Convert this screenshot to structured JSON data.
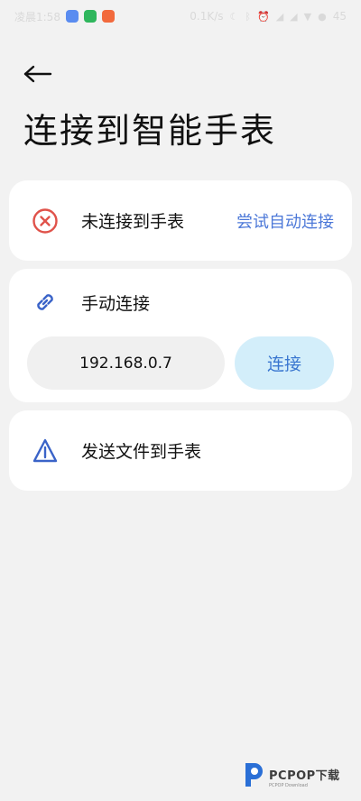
{
  "status_bar": {
    "time": "凌晨1:58",
    "network_speed": "0.1K/s",
    "battery": "45",
    "app_icons": [
      "blue-app-icon",
      "wechat-icon",
      "orange-app-icon"
    ]
  },
  "header": {
    "back_icon": "arrow-left-icon",
    "title": "连接到智能手表"
  },
  "connection_status": {
    "icon": "close-circle-icon",
    "icon_color": "#e0524a",
    "label": "未连接到手表",
    "action_label": "尝试自动连接",
    "action_color": "#4c78d8"
  },
  "manual_connect": {
    "icon": "link-icon",
    "icon_color": "#3a63c8",
    "label": "手动连接",
    "ip_value": "192.168.0.7",
    "connect_label": "连接",
    "button_color": "#d3eefa"
  },
  "send_file": {
    "icon": "send-triangle-icon",
    "icon_color": "#3a63c8",
    "label": "发送文件到手表"
  },
  "watermark": {
    "brand": "PCPOP下载",
    "sub": "PCPOP Download"
  }
}
